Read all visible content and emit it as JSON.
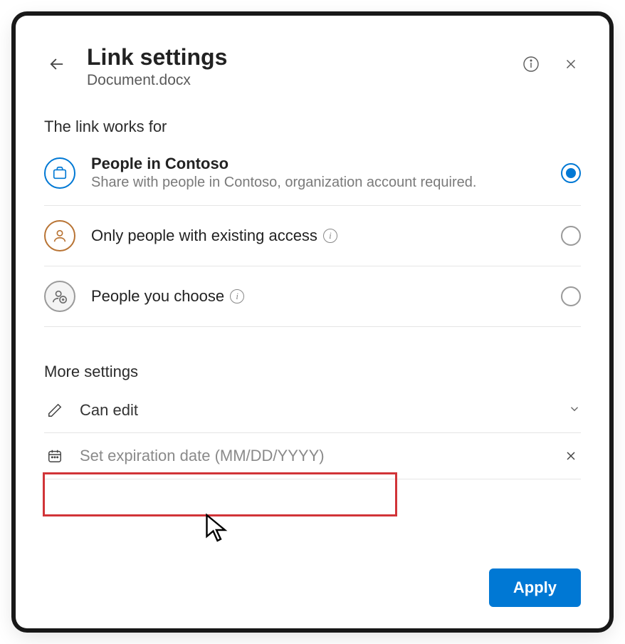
{
  "header": {
    "title": "Link settings",
    "subtitle": "Document.docx"
  },
  "sections": {
    "works_for_label": "The link works for",
    "more_settings_label": "More settings"
  },
  "options": [
    {
      "title": "People in Contoso",
      "desc": "Share with people in Contoso, organization account required.",
      "icon": "briefcase-icon",
      "selected": true
    },
    {
      "title": "Only people with existing access",
      "icon": "person-icon",
      "selected": false,
      "has_info": true
    },
    {
      "title": "People you choose",
      "icon": "person-add-icon",
      "selected": false,
      "has_info": true
    }
  ],
  "settings": {
    "permission_label": "Can edit",
    "expiration_placeholder": "Set expiration date (MM/DD/YYYY)"
  },
  "footer": {
    "apply_label": "Apply"
  }
}
